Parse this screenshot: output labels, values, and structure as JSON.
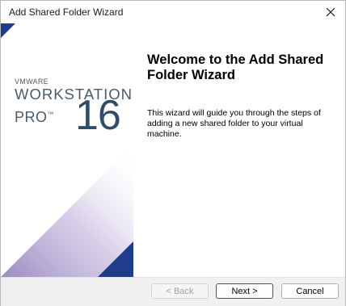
{
  "window": {
    "title": "Add Shared Folder Wizard"
  },
  "banner": {
    "brand": "VMWARE",
    "product": "WORKSTATION",
    "edition": "PRO",
    "trademark": "™",
    "version": "16",
    "colors": {
      "dark_blue": "#1f3d8a",
      "purple": "#8a76b6",
      "light_purple": "#d8d0ea",
      "logo_text": "#4b5a6b"
    }
  },
  "content": {
    "heading": "Welcome to the Add Shared Folder Wizard",
    "description": "This wizard will guide you through the steps of adding a new shared folder to your virtual machine."
  },
  "buttons": {
    "back": "< Back",
    "next": "Next >",
    "cancel": "Cancel"
  },
  "icons": {
    "close": "close-icon"
  }
}
